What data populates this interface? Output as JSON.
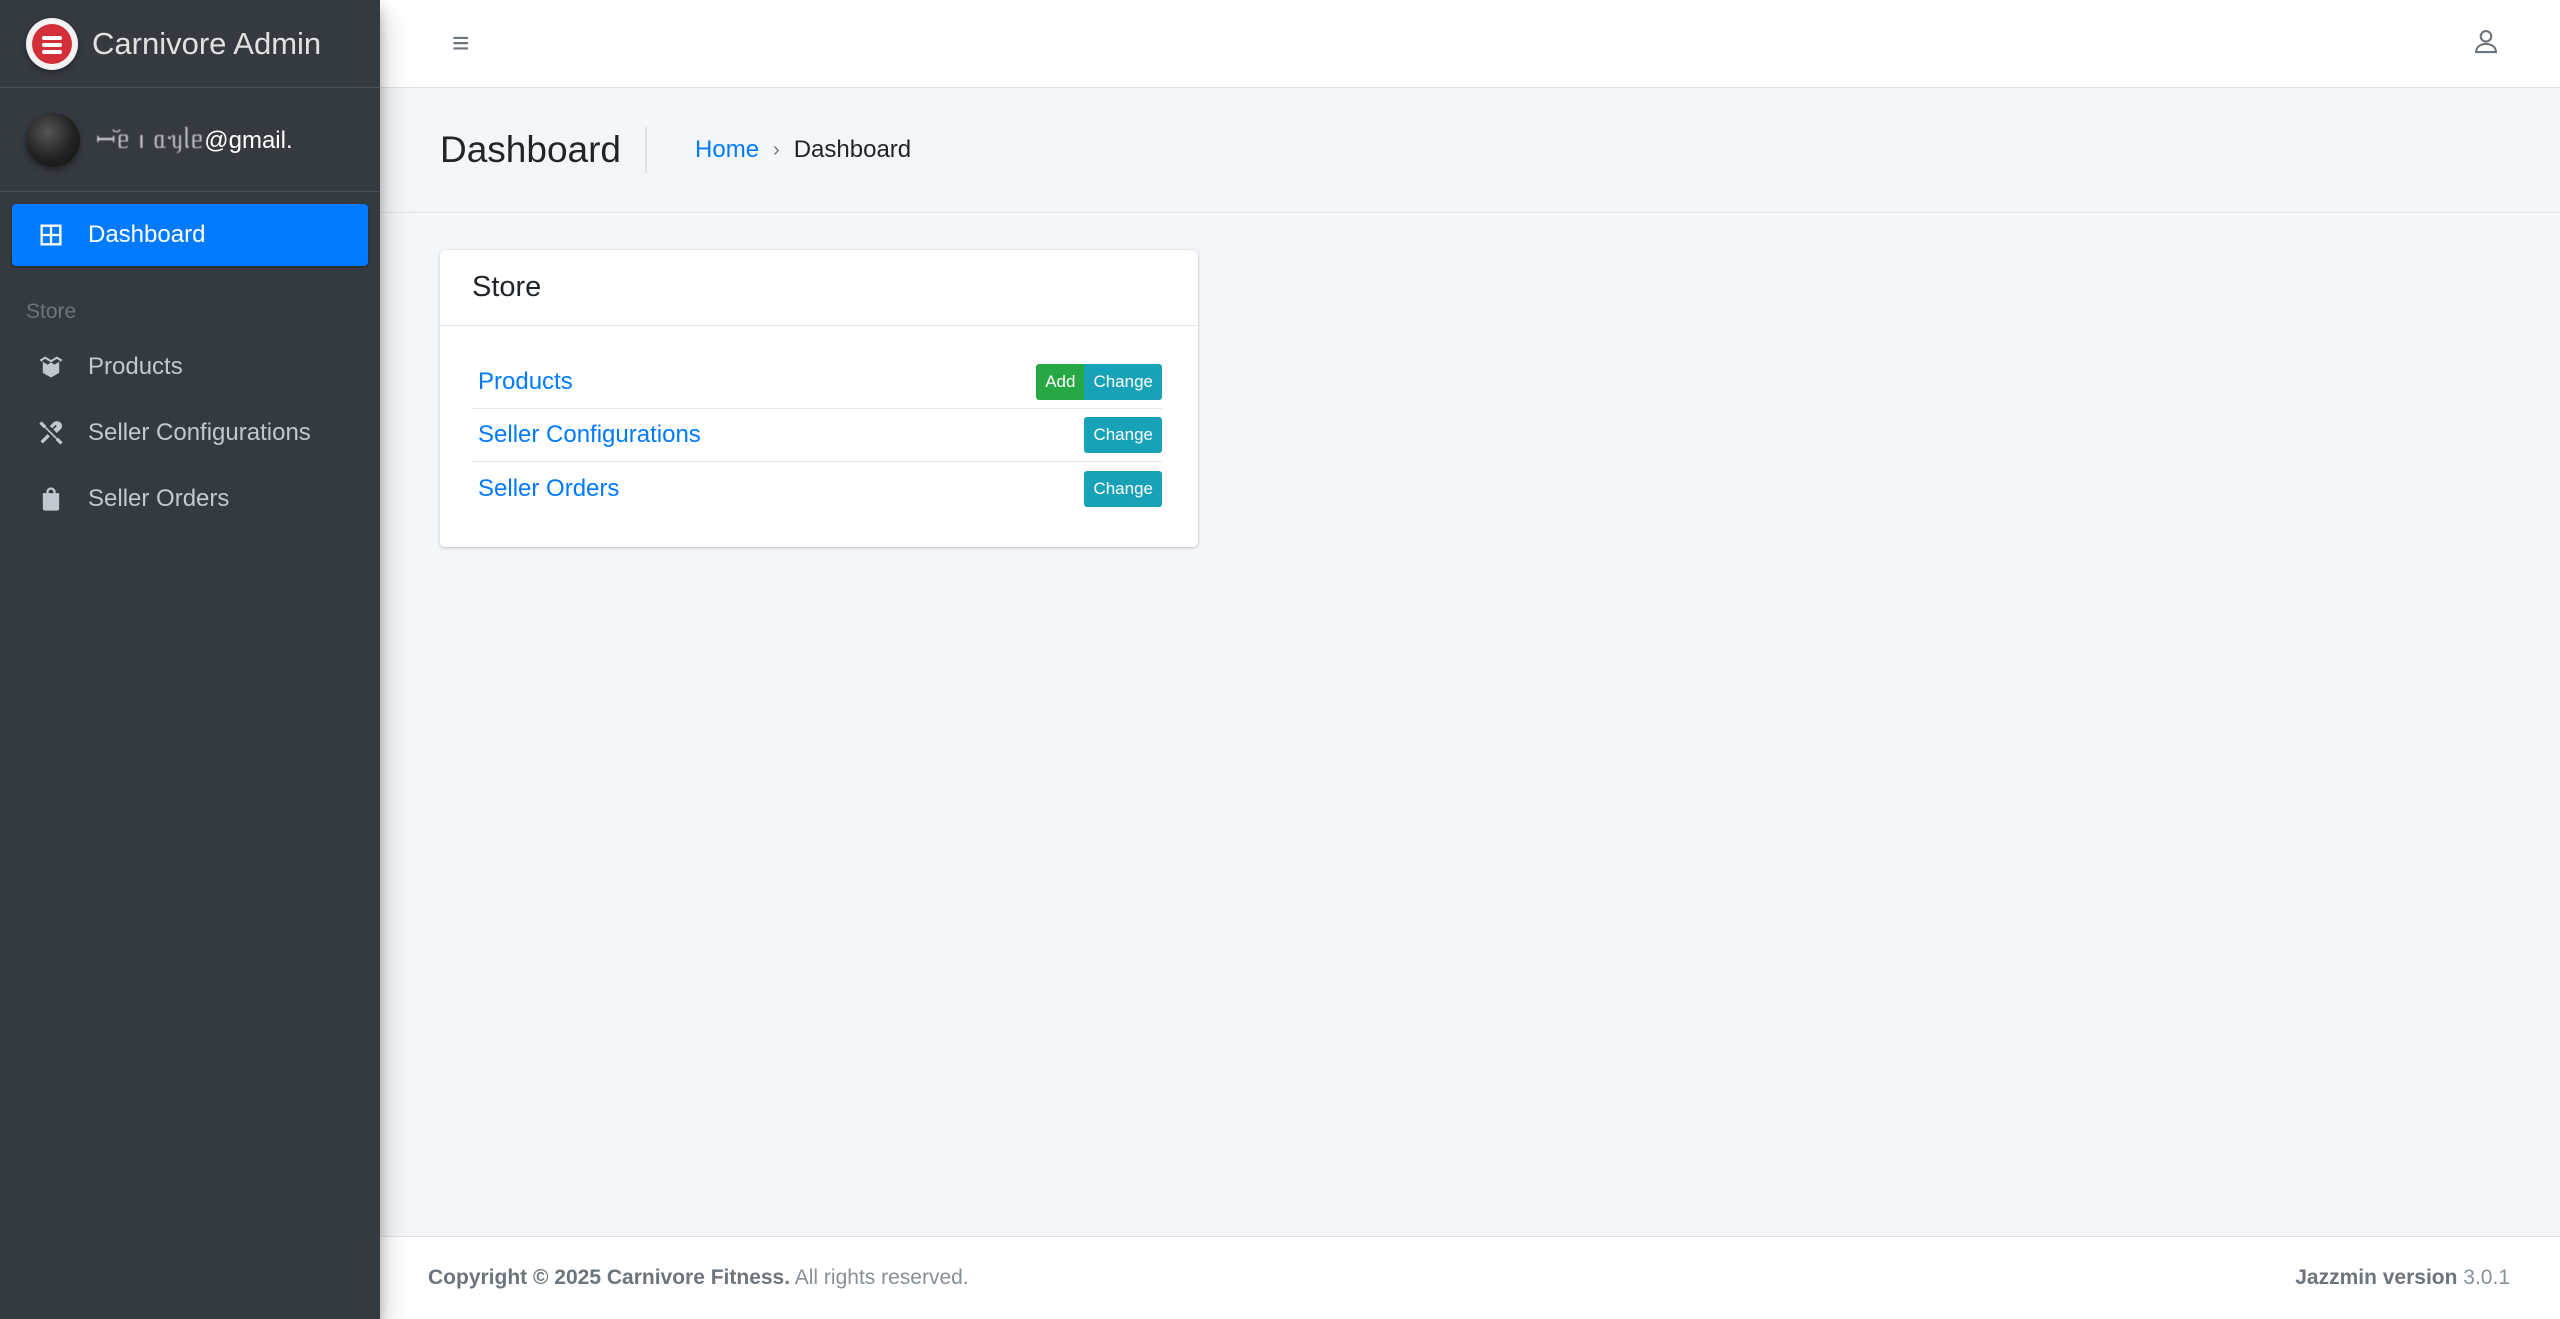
{
  "brand": {
    "name": "Carnivore Admin",
    "logo_icon": "brand-logo-icon"
  },
  "user": {
    "masked_part": "ꟷ꙼ᥱ ı ᥲᥡᥣᥱ",
    "email_suffix": "@gmail."
  },
  "sidebar": {
    "dashboard_label": "Dashboard",
    "section_header": "Store",
    "items": [
      {
        "label": "Products",
        "icon": "box-icon"
      },
      {
        "label": "Seller Configurations",
        "icon": "tools-icon"
      },
      {
        "label": "Seller Orders",
        "icon": "shopping-bag-icon"
      }
    ]
  },
  "header": {
    "menu_icon": "≡",
    "user_icon": "user-icon"
  },
  "content_header": {
    "title": "Dashboard",
    "breadcrumb_home": "Home",
    "breadcrumb_sep": "›",
    "breadcrumb_current": "Dashboard"
  },
  "store_card": {
    "title": "Store",
    "models": [
      {
        "name": "Products",
        "add_label": "Add",
        "change_label": "Change"
      },
      {
        "name": "Seller Configurations",
        "change_label": "Change"
      },
      {
        "name": "Seller Orders",
        "change_label": "Change"
      }
    ]
  },
  "footer": {
    "copyright_bold": "Copyright © 2025 Carnivore Fitness.",
    "copyright_rest": " All rights reserved.",
    "version_label": "Jazzmin version",
    "version_number": " 3.0.1"
  },
  "colors": {
    "primary": "#007bff",
    "success": "#28a745",
    "info": "#17a2b8",
    "sidebar_bg": "#343a40"
  }
}
